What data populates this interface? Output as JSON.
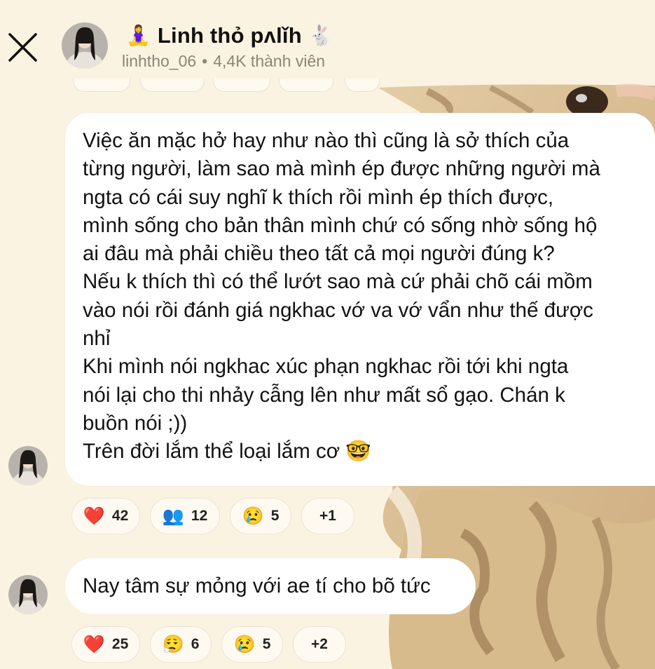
{
  "colors": {
    "background": "#fbf3e1",
    "bubble": "#ffffff",
    "subtle_text": "#8b8578",
    "pill_bg": "#fffaf1"
  },
  "header": {
    "title_emoji_left": "🧘‍♀️",
    "title": "Linh thỏ pʌlǐh",
    "title_emoji_right": "🐇",
    "username": "linhtho_06",
    "members": "4,4K thành viên",
    "separator": "•"
  },
  "messages": [
    {
      "text": "Việc ăn mặc hở hay như nào thì cũng là sở thích của\ntừng người, làm sao mà mình ép được những người mà\nngta có cái suy nghĩ k thích rồi mình ép thích được,\nmình sống cho bản thân mình chứ có sống nhờ sống hộ\nai đâu mà phải chiều theo tất cả mọi người đúng k?\nNếu k thích thì có thể lướt sao mà cứ phải chõ cái mồm\nvào nói rồi đánh giá ngkhac vớ va vớ vẩn như thế được\nnhỉ\nKhi mình nói ngkhac xúc phạn ngkhac rồi tới khi ngta\nnói lại cho thi nhảy cẫng lên như mất sổ gạo. Chán k\nbuồn nói ;))\nTrên đời lắm thể loại lắm cơ 🤓",
      "reactions": [
        {
          "icon": "❤️",
          "icon_name": "heart-icon",
          "count": "42"
        },
        {
          "icon": "👥",
          "icon_name": "people-icon",
          "count": "12"
        },
        {
          "icon": "😢",
          "icon_name": "crying-face-icon",
          "count": "5"
        },
        {
          "icon": "",
          "icon_name": "more-reactions",
          "count": "+1"
        }
      ]
    },
    {
      "text": "Nay tâm sự mỏng với ae tí cho bõ tức",
      "reactions": [
        {
          "icon": "❤️",
          "icon_name": "heart-icon",
          "count": "25"
        },
        {
          "icon": "😮‍💨",
          "icon_name": "exhale-face-icon",
          "count": "6"
        },
        {
          "icon": "😢",
          "icon_name": "crying-face-icon",
          "count": "5"
        },
        {
          "icon": "",
          "icon_name": "more-reactions",
          "count": "+2"
        }
      ]
    }
  ]
}
